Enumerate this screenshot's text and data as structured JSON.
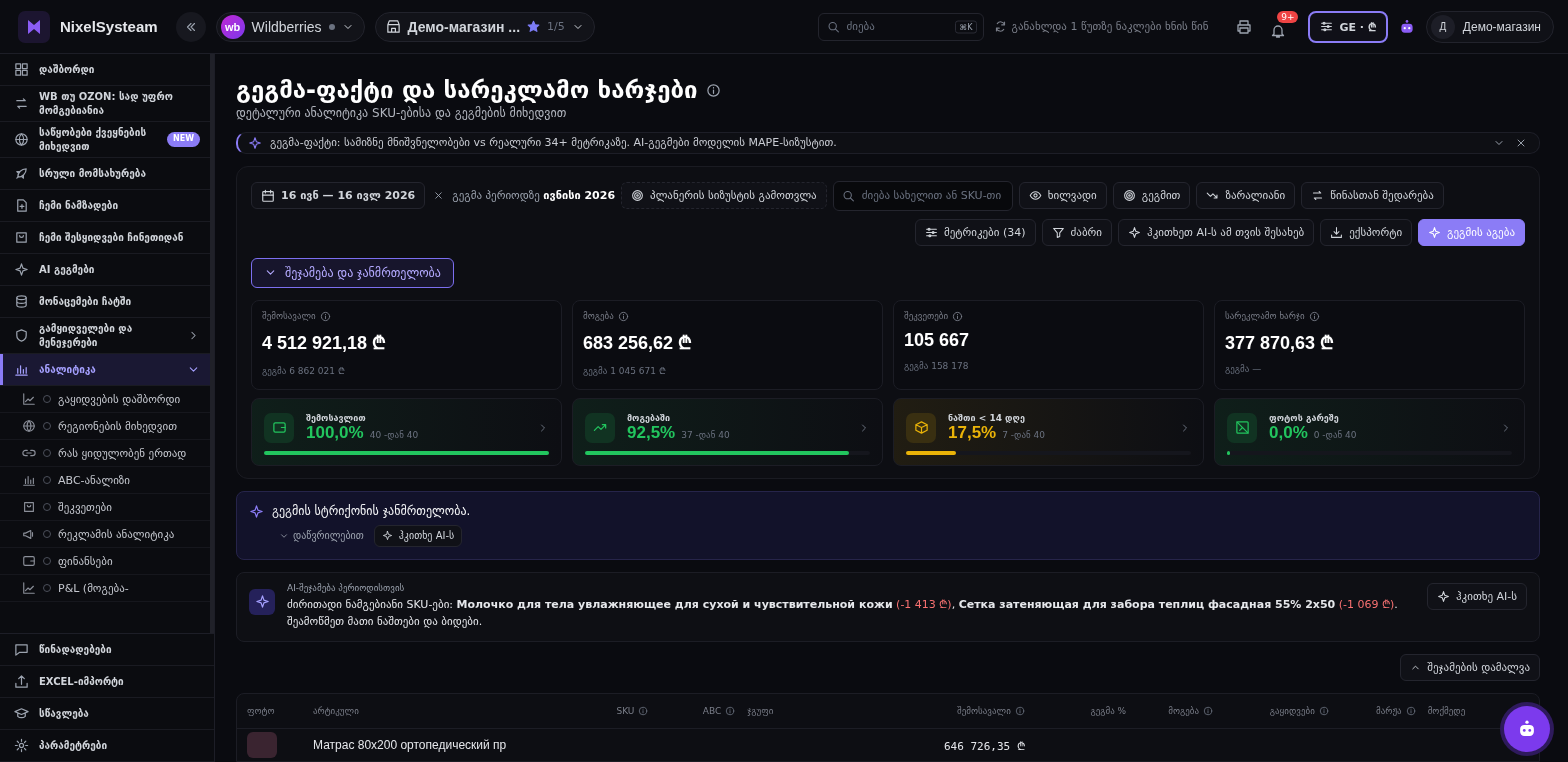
{
  "topbar": {
    "brand": "NixelSysteam",
    "marketplace": {
      "logo": "wb",
      "name": "Wildberries"
    },
    "store": {
      "name": "Демо-магазин ...",
      "counter": "1/5"
    },
    "search": {
      "placeholder": "ძიება",
      "shortcut": "⌘K"
    },
    "sync_status": "განახლდა 1 წუთზე ნაკლები ხნის წინ",
    "notifications": {
      "badge": "9+"
    },
    "locale": {
      "label": "GE · ₾"
    },
    "account": {
      "initial": "Д",
      "name": "Демо-магазин"
    }
  },
  "sidebar": {
    "items": [
      {
        "label": "დაშბორდი",
        "selected": false
      },
      {
        "label": "WB თუ OZON: სად უფრო მომგებიანია",
        "selected": false
      },
      {
        "label": "საწყობები ქვეყნების მიხედვით",
        "badge": "NEW",
        "selected": false
      },
      {
        "label": "სრული მომსახურება",
        "selected": false
      },
      {
        "label": "ჩემი ნამზადები",
        "selected": false
      },
      {
        "label": "ჩემი შესყიდვები ჩინეთიდან",
        "selected": false
      },
      {
        "label": "AI გეგმები",
        "selected": false
      },
      {
        "label": "მონაცემები ჩატში",
        "selected": false
      },
      {
        "label": "გამყიდველები და მენეჯერები",
        "selected": false,
        "expanded": false
      },
      {
        "label": "ანალიტიკა",
        "selected": true,
        "expanded": true,
        "children": [
          {
            "label": "გაყიდვების დაშბორდი",
            "selected": false
          },
          {
            "label": "რეგიონების მიხედვით",
            "selected": false
          },
          {
            "label": "რას ყიდულობენ ერთად",
            "selected": false
          },
          {
            "label": "ABC-ანალიზი",
            "selected": false
          },
          {
            "label": "შეკვეთები",
            "selected": false
          },
          {
            "label": "რეკლამის ანალიტიკა",
            "selected": false
          },
          {
            "label": "ფინანსები",
            "selected": false
          },
          {
            "label": "P&L (მოგება-",
            "selected": false
          }
        ]
      }
    ],
    "bottom_items": [
      {
        "label": "წინადადებები",
        "selected": false
      },
      {
        "label": "EXCEL-იმპორტი",
        "selected": false
      },
      {
        "label": "სწავლება",
        "selected": false
      },
      {
        "label": "პარამეტრები",
        "selected": false
      }
    ]
  },
  "header": {
    "title": "გეგმა-ფაქტი და სარეკლამო ხარჯები",
    "subtitle": "დეტალური ანალიტიკა SKU-ებისა და გეგმების მიხედვით"
  },
  "banner": {
    "text": "გეგმა-ფაქტი: სამიზნე მნიშვნელობები vs რეალური 34+ მეტრიკაზე. AI-გეგმები მოდელის MAPE-სიზუსტით."
  },
  "toolbar": {
    "date_range": "16 ივნ — 16 ივლ 2026",
    "plan_period": "გეგმა პერიოდზე **ივნისი 2026**",
    "precision_button": "პლანერის სიზუსტის გამოთვლა",
    "search": {
      "placeholder": "ძიება სახელით ან SKU-თი"
    },
    "toggles": [
      {
        "label": "ხილვადი",
        "selected": false
      },
      {
        "label": "გეგმით",
        "selected": false
      },
      {
        "label": "ზარალიანი",
        "selected": false
      },
      {
        "label": "წინასთან შედარება",
        "selected": false
      }
    ],
    "actions": [
      {
        "label": "მეტრიკები (34)",
        "kind": "default"
      },
      {
        "label": "ძაბრი",
        "kind": "default"
      },
      {
        "label": "ჰკითხეთ AI-ს ამ თვის შესახებ",
        "kind": "default"
      },
      {
        "label": "ექსპორტი",
        "kind": "default"
      },
      {
        "label": "გეგმის აგება",
        "kind": "primary"
      }
    ]
  },
  "summary_toggle": {
    "label": "შეჯამება და ჯანმრთელობა",
    "expanded": true
  },
  "metrics": [
    {
      "label": "შემოსავალი",
      "value": "4 512 921,18 ₾",
      "plan": "გეგმა 6 862 021 ₾"
    },
    {
      "label": "მოგება",
      "value": "683 256,62 ₾",
      "plan": "გეგმა 1 045 671 ₾"
    },
    {
      "label": "შეკვეთები",
      "value": "105 667",
      "plan": "გეგმა 158 178"
    },
    {
      "label": "სარეკლამო ხარჯი",
      "value": "377 870,63 ₾",
      "plan": "გეგმა —"
    }
  ],
  "health": [
    {
      "label": "შემოსავლით",
      "value": "100,0%",
      "count": "40 -დან 40",
      "level": 1.0,
      "color": "#22c55e"
    },
    {
      "label": "მოგებაში",
      "value": "92,5%",
      "count": "37 -დან 40",
      "level": 0.925,
      "color": "#22c55e"
    },
    {
      "label": "ნაშთი < 14 დღე",
      "value": "17,5%",
      "count": "7 -დან 40",
      "level": 0.175,
      "color": "#eab308"
    },
    {
      "label": "ფოტოს გარეშე",
      "value": "0,0%",
      "count": "0 -დან 40",
      "level": 0.0,
      "color": "#22c55e"
    }
  ],
  "insight": {
    "title": "გეგმის სტრიქონის ჯანმრთელობა.",
    "details": {
      "label": "დაწვრილებით",
      "expanded": false
    },
    "ask_button": "ჰკითხე AI-ს"
  },
  "ai_summary": {
    "label": "AI-შეჯამება პერიოდისთვის",
    "segments": [
      {
        "kind": "plain",
        "text": "ძირითადი ნამგებიანი SKU-ები: "
      },
      {
        "kind": "bold",
        "text": "Молочко для тела увлажняющее для сухой и чувствительной кожи"
      },
      {
        "kind": "loss",
        "text": " (-1 413 ₾)"
      },
      {
        "kind": "plain",
        "text": ", "
      },
      {
        "kind": "bold",
        "text": "Сетка затеняющая для забора теплиц фасадная 55% 2x50"
      },
      {
        "kind": "loss",
        "text": " (-1 069 ₾)"
      },
      {
        "kind": "plain",
        "text": ". შეამოწმეთ მათი ნაშთები და ბიდები."
      }
    ],
    "ask_button": "ჰკითხე AI-ს"
  },
  "hide_summary_button": "შეჯამების დამალვა",
  "table": {
    "columns": [
      {
        "label": "ფოტო",
        "info": false
      },
      {
        "label": "არტიკული",
        "info": false
      },
      {
        "label": "SKU",
        "info": true
      },
      {
        "label": "ABC",
        "info": true
      },
      {
        "label": "ჯგუფი",
        "info": false
      },
      {
        "label": "შემოსავალი",
        "info": true
      },
      {
        "label": "გეგმა %",
        "info": false
      },
      {
        "label": "მოგება",
        "info": true
      },
      {
        "label": "გაყიდვები",
        "info": true
      },
      {
        "label": "მარჟა",
        "info": true
      },
      {
        "label": "მოქმედე",
        "info": false
      }
    ],
    "rows": [
      {
        "article": "Матрас 80x200 ортопедический пр",
        "revenue": "646 726,35 ₾"
      }
    ]
  }
}
